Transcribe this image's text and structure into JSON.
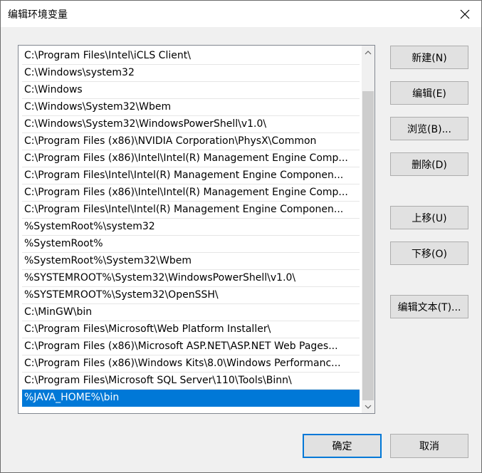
{
  "window": {
    "title": "编辑环境变量"
  },
  "list": {
    "items": [
      "C:\\Program Files\\Intel\\iCLS Client\\",
      "C:\\Windows\\system32",
      "C:\\Windows",
      "C:\\Windows\\System32\\Wbem",
      "C:\\Windows\\System32\\WindowsPowerShell\\v1.0\\",
      "C:\\Program Files (x86)\\NVIDIA Corporation\\PhysX\\Common",
      "C:\\Program Files (x86)\\Intel\\Intel(R) Management Engine Comp...",
      "C:\\Program Files\\Intel\\Intel(R) Management Engine Componen...",
      "C:\\Program Files (x86)\\Intel\\Intel(R) Management Engine Comp...",
      "C:\\Program Files\\Intel\\Intel(R) Management Engine Componen...",
      "%SystemRoot%\\system32",
      "%SystemRoot%",
      "%SystemRoot%\\System32\\Wbem",
      "%SYSTEMROOT%\\System32\\WindowsPowerShell\\v1.0\\",
      "%SYSTEMROOT%\\System32\\OpenSSH\\",
      "C:\\MinGW\\bin",
      "C:\\Program Files\\Microsoft\\Web Platform Installer\\",
      "C:\\Program Files (x86)\\Microsoft ASP.NET\\ASP.NET Web Pages...",
      "C:\\Program Files (x86)\\Windows Kits\\8.0\\Windows Performanc...",
      "C:\\Program Files\\Microsoft SQL Server\\110\\Tools\\Binn\\",
      "%JAVA_HOME%\\bin"
    ],
    "selected_index": 20
  },
  "buttons": {
    "new": "新建(N)",
    "edit": "编辑(E)",
    "browse": "浏览(B)...",
    "delete": "删除(D)",
    "move_up": "上移(U)",
    "move_down": "下移(O)",
    "edit_text": "编辑文本(T)...",
    "ok": "确定",
    "cancel": "取消"
  },
  "colors": {
    "selection": "#0078d7",
    "focus_border": "#0078d7"
  },
  "icons": {
    "close": "close-icon",
    "scroll_up": "chevron-up-icon",
    "scroll_down": "chevron-down-icon"
  }
}
